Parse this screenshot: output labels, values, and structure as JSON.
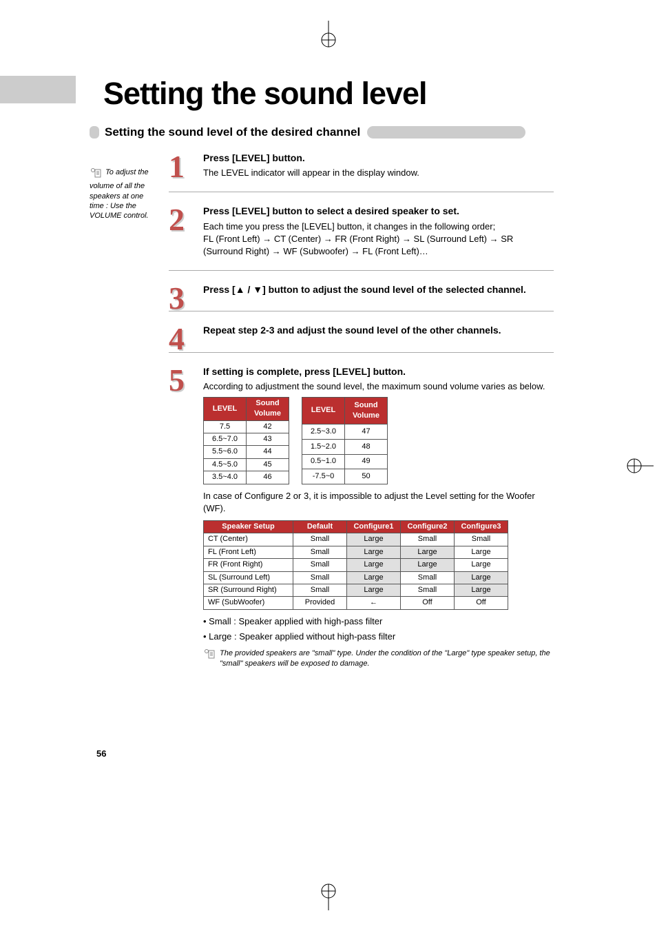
{
  "title": "Setting the sound level",
  "section_title": "Setting the sound level of the desired channel",
  "sidebar_note": "To adjust the volume of all the speakers at one time : Use the VOLUME control.",
  "steps": [
    {
      "num": "1",
      "title": "Press [LEVEL] button.",
      "body": "The LEVEL indicator will appear in the display window."
    },
    {
      "num": "2",
      "title": "Press [LEVEL] button to select a desired speaker to set.",
      "body_intro": "Each time you press the [LEVEL] button, it changes in the following order;",
      "body_seq": "FL (Front Left) → CT (Center) → FR (Front Right) → SL (Surround Left) → SR (Surround Right) → WF (Subwoofer) → FL (Front Left)…"
    },
    {
      "num": "3",
      "title_pre": "Press [",
      "title_mid": " / ",
      "title_post": "] button to adjust the sound level of the selected channel."
    },
    {
      "num": "4",
      "title": "Repeat step 2-3 and adjust the sound level of the other channels."
    },
    {
      "num": "5",
      "title": "If setting is complete, press [LEVEL] button.",
      "body": "According to adjustment the sound level, the maximum sound volume varies as below."
    }
  ],
  "level_table_headers": [
    "LEVEL",
    "Sound Volume"
  ],
  "level_table_left": [
    [
      "7.5",
      "42"
    ],
    [
      "6.5~7.0",
      "43"
    ],
    [
      "5.5~6.0",
      "44"
    ],
    [
      "4.5~5.0",
      "45"
    ],
    [
      "3.5~4.0",
      "46"
    ]
  ],
  "level_table_right": [
    [
      "2.5~3.0",
      "47"
    ],
    [
      "1.5~2.0",
      "48"
    ],
    [
      "0.5~1.0",
      "49"
    ],
    [
      "-7.5~0",
      "50"
    ]
  ],
  "configure_note": "In case of Configure 2 or 3, it is impossible to adjust the Level setting for the Woofer (WF).",
  "config_headers": [
    "Speaker Setup",
    "Default",
    "Configure1",
    "Configure2",
    "Configure3"
  ],
  "config_rows": [
    {
      "cells": [
        "CT (Center)",
        "Small",
        "Large",
        "Small",
        "Small"
      ],
      "shade": [
        false,
        false,
        true,
        false,
        false
      ]
    },
    {
      "cells": [
        "FL (Front Left)",
        "Small",
        "Large",
        "Large",
        "Large"
      ],
      "shade": [
        false,
        false,
        true,
        true,
        false
      ]
    },
    {
      "cells": [
        "FR (Front Right)",
        "Small",
        "Large",
        "Large",
        "Large"
      ],
      "shade": [
        false,
        false,
        true,
        true,
        false
      ]
    },
    {
      "cells": [
        "SL (Surround Left)",
        "Small",
        "Large",
        "Small",
        "Large"
      ],
      "shade": [
        false,
        false,
        true,
        false,
        true
      ]
    },
    {
      "cells": [
        "SR (Surround Right)",
        "Small",
        "Large",
        "Small",
        "Large"
      ],
      "shade": [
        false,
        false,
        true,
        false,
        true
      ]
    },
    {
      "cells": [
        "WF (SubWoofer)",
        "Provided",
        "←",
        "Off",
        "Off"
      ],
      "shade": [
        false,
        false,
        false,
        false,
        false
      ]
    }
  ],
  "bullets": [
    "• Small : Speaker applied with high-pass filter",
    "• Large : Speaker applied without high-pass filter"
  ],
  "footer_note": "The provided speakers are \"small\" type. Under the condition of the \"Large\" type speaker setup, the \"small\" speakers will be exposed to damage.",
  "page_num": "56"
}
